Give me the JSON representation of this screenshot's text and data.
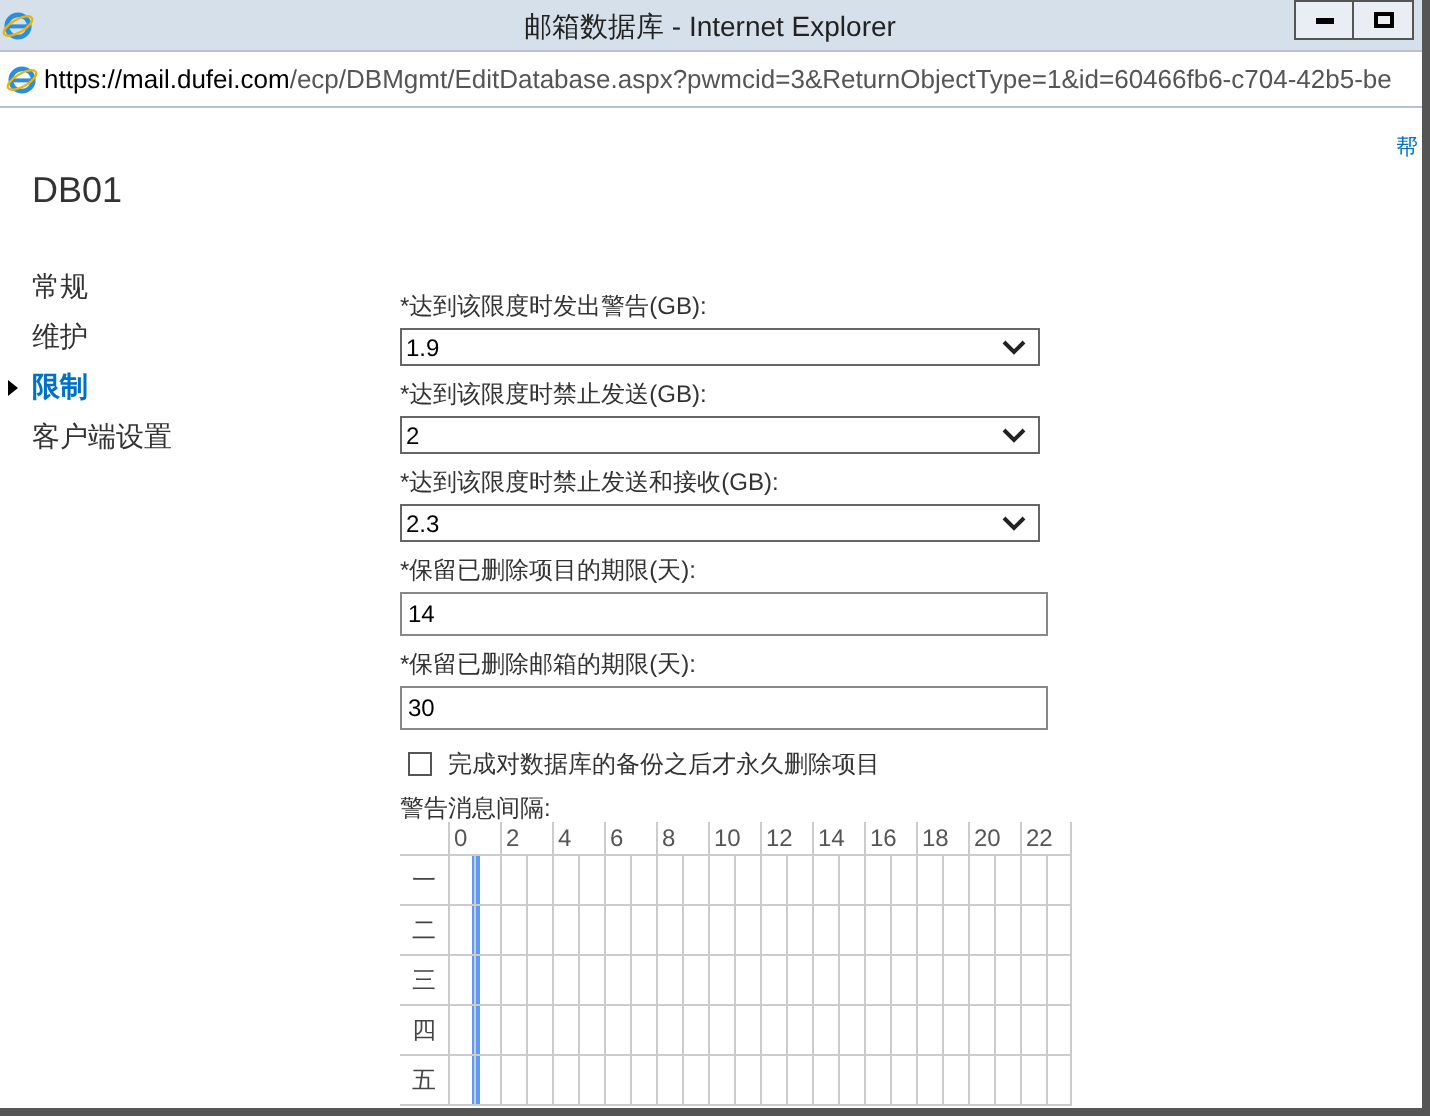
{
  "window": {
    "title": "邮箱数据库 - Internet Explorer",
    "url_host_prefix": "https://mail.",
    "url_host_bold": "dufei.com",
    "url_path": "/ecp/DBMgmt/EditDatabase.aspx?pwmcid=3&ReturnObjectType=1&id=60466fb6-c704-42b5-be"
  },
  "help_link": "帮",
  "page_title": "DB01",
  "nav": [
    {
      "label": "常规",
      "selected": false
    },
    {
      "label": "维护",
      "selected": false
    },
    {
      "label": "限制",
      "selected": true
    },
    {
      "label": "客户端设置",
      "selected": false
    }
  ],
  "fields": [
    {
      "kind": "select",
      "label": "*达到该限度时发出警告(GB):",
      "value": "1.9"
    },
    {
      "kind": "select",
      "label": "*达到该限度时禁止发送(GB):",
      "value": "2"
    },
    {
      "kind": "select",
      "label": "*达到该限度时禁止发送和接收(GB):",
      "value": "2.3"
    },
    {
      "kind": "text",
      "label": "*保留已删除项目的期限(天):",
      "value": "14"
    },
    {
      "kind": "text",
      "label": "*保留已删除邮箱的期限(天):",
      "value": "30"
    }
  ],
  "checkbox": {
    "label": "完成对数据库的备份之后才永久删除项目",
    "checked": false
  },
  "schedule": {
    "label": "警告消息间隔:",
    "hours": [
      "0",
      "2",
      "4",
      "6",
      "8",
      "10",
      "12",
      "14",
      "16",
      "18",
      "20",
      "22"
    ],
    "days": [
      {
        "label": "一",
        "marked": true
      },
      {
        "label": "二",
        "marked": true
      },
      {
        "label": "三",
        "marked": true
      },
      {
        "label": "四",
        "marked": true
      },
      {
        "label": "五",
        "marked": true
      }
    ]
  }
}
